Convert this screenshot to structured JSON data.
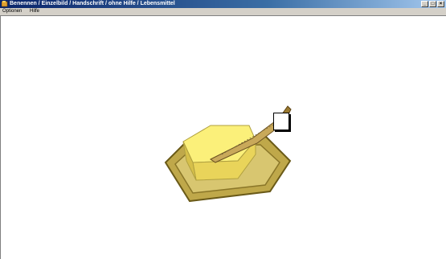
{
  "window": {
    "title": "Benennen / Einzelbild / Handschrift / ohne Hilfe / Lebensmittel",
    "icon": "app-icon",
    "buttons": [
      "minimize-icon",
      "maximize-icon",
      "close-icon"
    ]
  },
  "menu": {
    "items": [
      {
        "label": "Optionen"
      },
      {
        "label": "Hilfe"
      }
    ]
  },
  "stimulus": {
    "image": "butter-dish-with-knife",
    "response_box": "handwriting-answer-box"
  }
}
